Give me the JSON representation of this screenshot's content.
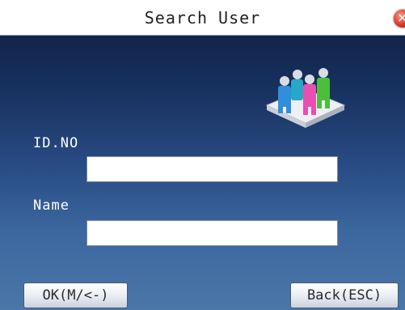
{
  "window": {
    "title": "Search User"
  },
  "icons": {
    "close": "close-icon",
    "users": "users-icon"
  },
  "form": {
    "id_label": "ID.NO",
    "id_value": "",
    "name_label": "Name",
    "name_value": ""
  },
  "buttons": {
    "ok": "OK(M/<-)",
    "back": "Back(ESC)"
  },
  "colors": {
    "title_bar": "#ffffff",
    "background_top": "#0d1d3f",
    "background_bottom": "#4b76a8"
  }
}
